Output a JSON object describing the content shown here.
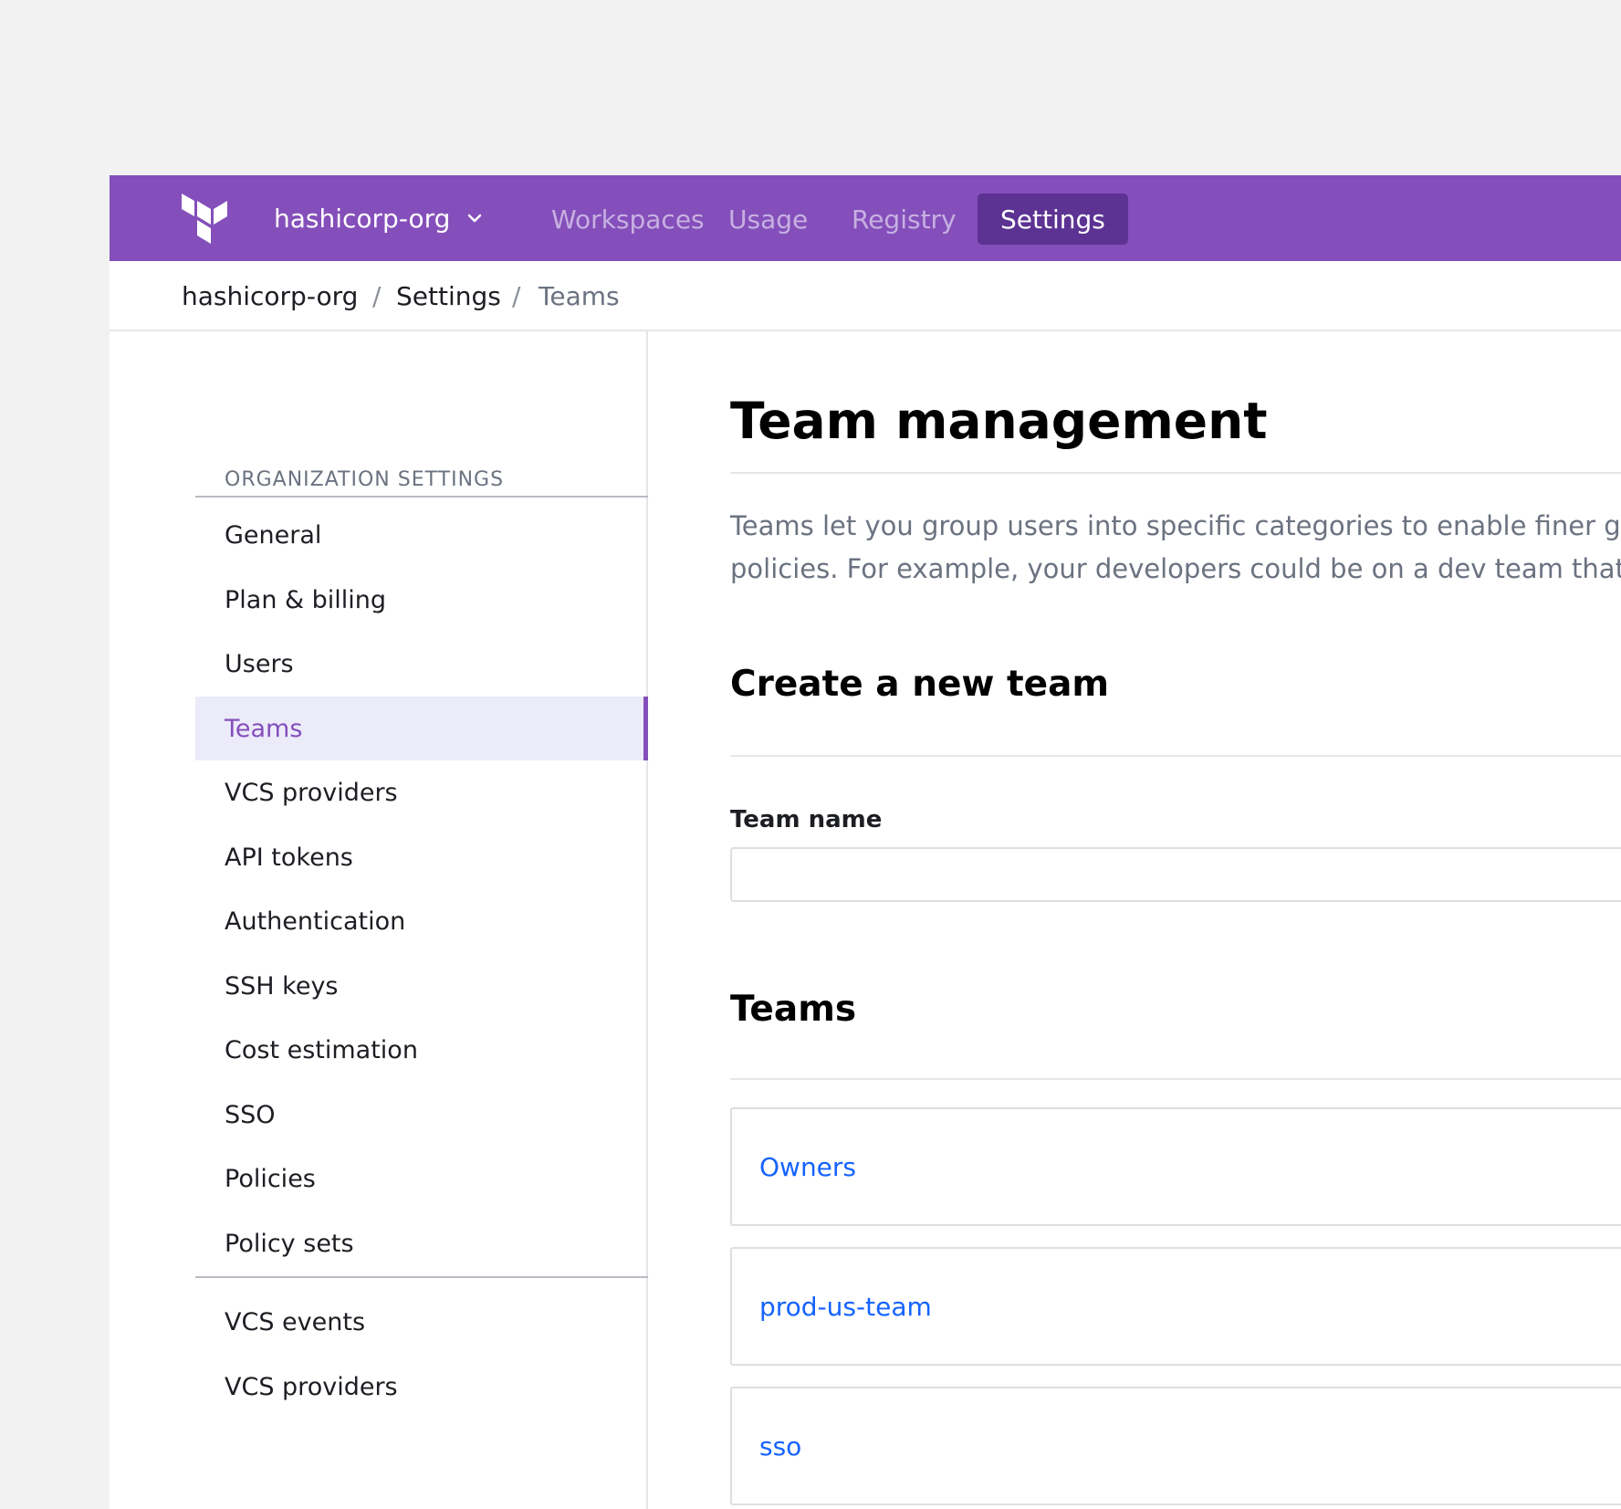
{
  "topnav": {
    "org_name": "hashicorp-org",
    "links": [
      {
        "label": "Workspaces"
      },
      {
        "label": "Usage"
      },
      {
        "label": "Registry"
      },
      {
        "label": "Settings",
        "active": true
      }
    ],
    "colors": {
      "background": "#844fba",
      "active": "#5c3292",
      "inactive_text": "#c7b0e2"
    }
  },
  "breadcrumb": [
    "hashicorp-org",
    "Settings",
    "Teams"
  ],
  "sidebar": {
    "heading": "ORGANIZATION SETTINGS",
    "items": [
      {
        "label": "General"
      },
      {
        "label": "Plan & billing"
      },
      {
        "label": "Users"
      },
      {
        "label": "Teams",
        "active": true
      },
      {
        "label": "VCS providers"
      },
      {
        "label": "API tokens"
      },
      {
        "label": "Authentication"
      },
      {
        "label": "SSH keys"
      },
      {
        "label": "Cost estimation"
      },
      {
        "label": "SSO"
      },
      {
        "label": "Policies"
      },
      {
        "label": "Policy sets"
      }
    ],
    "secondary_items": [
      {
        "label": "VCS events"
      },
      {
        "label": "VCS providers"
      }
    ]
  },
  "main": {
    "title": "Team management",
    "description_line1": "Teams let you group users into specific categories to enable finer gr",
    "description_line2": "policies. For example, your developers could be on a dev team that",
    "create_section_title": "Create a new team",
    "team_name_label": "Team name",
    "team_name_value": "",
    "teams_section_title": "Teams",
    "teams": [
      "Owners",
      "prod-us-team",
      "sso"
    ],
    "link_color": "#1563ff"
  }
}
